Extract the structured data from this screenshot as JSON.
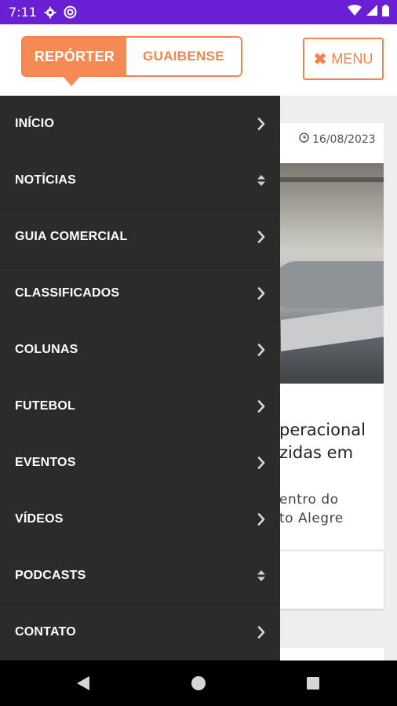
{
  "status_bar": {
    "time": "7:11",
    "left_icons": [
      "gear-icon",
      "sync-icon"
    ],
    "right_icons": [
      "wifi-icon",
      "signal-icon",
      "battery-icon"
    ]
  },
  "header": {
    "logo_part1": "REPÓRTER",
    "logo_part2": "GUAIBENSE",
    "menu_button_label": "MENU",
    "menu_button_icon": "close-icon",
    "accent_color": "#f5834a"
  },
  "background": {
    "date": "16/08/2023",
    "title_line1": "peracional",
    "title_line2": "zidas em",
    "subtitle_line1": "entro do",
    "subtitle_line2": "to Alegre"
  },
  "drawer": {
    "items": [
      {
        "label": "INÍCIO",
        "icon": "chevron-right-icon"
      },
      {
        "label": "NOTÍCIAS",
        "icon": "sort-icon"
      },
      {
        "label": "GUIA COMERCIAL",
        "icon": "chevron-right-icon"
      },
      {
        "label": "CLASSIFICADOS",
        "icon": "chevron-right-icon"
      },
      {
        "label": "COLUNAS",
        "icon": "chevron-right-icon"
      },
      {
        "label": "FUTEBOL",
        "icon": "chevron-right-icon"
      },
      {
        "label": "EVENTOS",
        "icon": "chevron-right-icon"
      },
      {
        "label": "VÍDEOS",
        "icon": "chevron-right-icon"
      },
      {
        "label": "PODCASTS",
        "icon": "sort-icon"
      },
      {
        "label": "CONTATO",
        "icon": "chevron-right-icon"
      }
    ]
  },
  "nav_bar": {
    "buttons": [
      "back-icon",
      "home-icon",
      "recents-icon"
    ]
  }
}
